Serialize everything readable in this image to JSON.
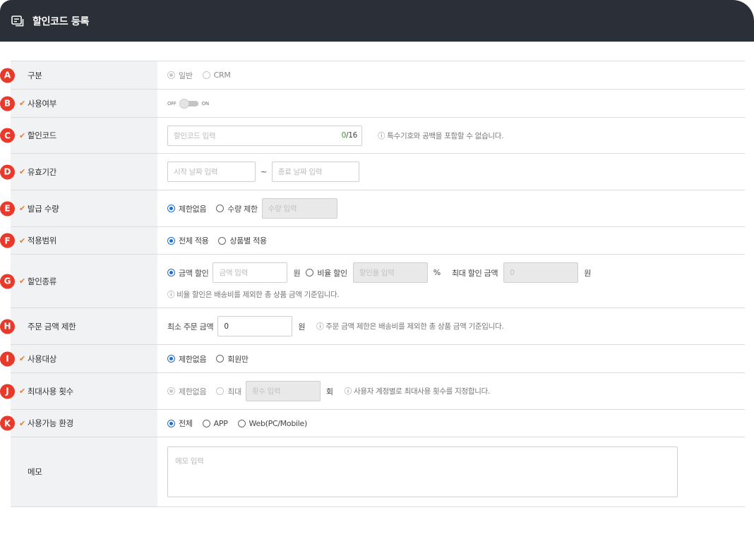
{
  "header": {
    "title": "할인코드 등록",
    "icon": "coupon-list-icon"
  },
  "badges": [
    "A",
    "B",
    "C",
    "D",
    "E",
    "F",
    "G",
    "H",
    "I",
    "J",
    "K"
  ],
  "rows": {
    "category": {
      "label": "구분",
      "options": [
        "일반",
        "CRM"
      ]
    },
    "usage": {
      "label": "사용여부",
      "off": "OFF",
      "on": "ON"
    },
    "code": {
      "label": "할인코드",
      "placeholder": "할인코드 입력",
      "count": "0",
      "max": "/16",
      "note": "ⓘ 특수기호와 공백을 포함할 수 없습니다."
    },
    "period": {
      "label": "유효기간",
      "start_placeholder": "시작 날짜 입력",
      "sep": "~",
      "end_placeholder": "종료 날짜 입력"
    },
    "issue": {
      "label": "발급 수량",
      "opt_unlimited": "제한없음",
      "opt_limit": "수량 제한",
      "placeholder": "수량 입력"
    },
    "scope": {
      "label": "적용범위",
      "opt_all": "전체 적용",
      "opt_product": "상품별 적용"
    },
    "type": {
      "label": "할인종류",
      "opt_amount": "금액 할인",
      "amount_placeholder": "금액 입력",
      "won": "원",
      "opt_rate": "비율 할인",
      "rate_placeholder": "할인율 입력",
      "percent": "%",
      "max_label": "최대 할인 금액",
      "max_value": "0",
      "won2": "원",
      "note": "ⓘ 비율 할인은 배송비를 제외한 총 상품 금액 기준입니다."
    },
    "min_order": {
      "label": "주문 금액 제한",
      "prefix": "최소 주문 금액",
      "value": "0",
      "won": "원",
      "note": "ⓘ 주문 금액 제한은 배송비를 제외한 총 상품 금액 기준입니다."
    },
    "target": {
      "label": "사용대상",
      "opt_unlimited": "제한없음",
      "opt_member": "회원만"
    },
    "max_use": {
      "label": "최대사용 횟수",
      "opt_unlimited": "제한없음",
      "opt_max": "최대",
      "placeholder": "횟수 입력",
      "unit": "회",
      "note": "ⓘ 사용자 계정별로 최대사용 횟수를 지정합니다."
    },
    "env": {
      "label": "사용가능 환경",
      "opt_all": "전체",
      "opt_app": "APP",
      "opt_web": "Web(PC/Mobile)"
    },
    "memo": {
      "label": "메모",
      "placeholder": "메모 입력"
    }
  },
  "colors": {
    "header_bg": "#2b2f38",
    "badge": "#e8392a",
    "required_check": "#f07a2a",
    "radio_on": "#1d6fd1",
    "label_bg": "#f1f2f4"
  }
}
